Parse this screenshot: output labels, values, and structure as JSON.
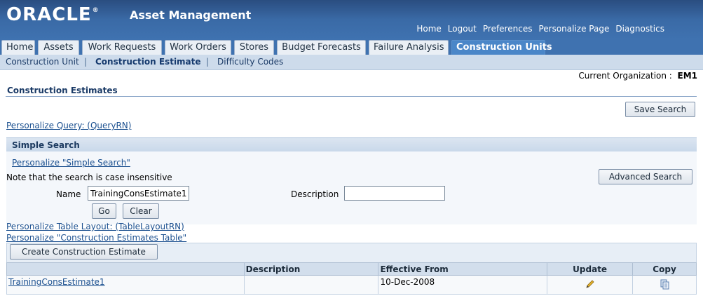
{
  "header": {
    "logo_text": "ORACLE",
    "logo_mark": "®",
    "app_title": "Asset Management",
    "global_links": [
      "Home",
      "Logout",
      "Preferences",
      "Personalize Page",
      "Diagnostics"
    ]
  },
  "tabs": [
    {
      "label": "Home",
      "active": false
    },
    {
      "label": "Assets",
      "active": false
    },
    {
      "label": "Work Requests",
      "active": false
    },
    {
      "label": "Work Orders",
      "active": false
    },
    {
      "label": "Stores",
      "active": false
    },
    {
      "label": "Budget Forecasts",
      "active": false
    },
    {
      "label": "Failure Analysis",
      "active": false
    },
    {
      "label": "Construction Units",
      "active": true
    }
  ],
  "subtabs": [
    {
      "label": "Construction Unit",
      "active": false
    },
    {
      "label": "Construction Estimate",
      "active": true
    },
    {
      "label": "Difficulty Codes",
      "active": false
    }
  ],
  "org": {
    "label": "Current Organization :",
    "value": "EM1"
  },
  "page": {
    "heading": "Construction Estimates",
    "save_search": "Save Search",
    "personalize_query": "Personalize Query: (QueryRN)"
  },
  "search": {
    "panel_title": "Simple Search",
    "personalize_link": "Personalize \"Simple Search\"",
    "note": "Note that the search is case insensitive",
    "advanced_button": "Advanced Search",
    "name_label": "Name",
    "name_value": "TrainingConsEstimate1",
    "description_label": "Description",
    "description_value": "",
    "go_button": "Go",
    "clear_button": "Clear"
  },
  "table_section": {
    "personalize_layout": "Personalize Table Layout: (TableLayoutRN)",
    "personalize_table": "Personalize \"Construction Estimates Table\"",
    "create_button": "Create Construction Estimate",
    "columns": [
      "",
      "Description",
      "Effective From",
      "Update",
      "Copy"
    ],
    "rows": [
      {
        "name": "TrainingConsEstimate1",
        "description": "",
        "effective_from": "10-Dec-2008"
      }
    ]
  },
  "icons": {
    "update": "pencil-icon",
    "copy": "copy-icon"
  },
  "colors": {
    "header_blue": "#3f72b0",
    "link": "#1a4f8f",
    "active_tab": "#4a86c8"
  }
}
